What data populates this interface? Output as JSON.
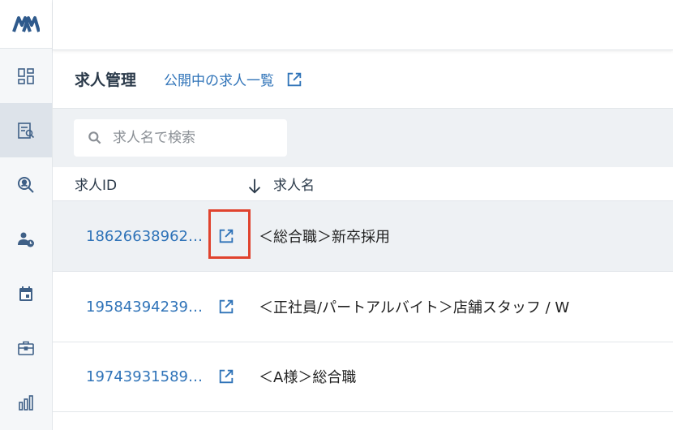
{
  "sidebar": {
    "logo_text": "M",
    "items": [
      {
        "icon": "dashboard-icon"
      },
      {
        "icon": "job-document-search-icon",
        "active": true
      },
      {
        "icon": "candidate-search-icon"
      },
      {
        "icon": "user-clock-icon"
      },
      {
        "icon": "calendar-icon"
      },
      {
        "icon": "briefcase-icon"
      },
      {
        "icon": "bar-chart-icon"
      }
    ]
  },
  "header": {
    "title": "求人管理",
    "link_label": "公開中の求人一覧"
  },
  "search": {
    "placeholder": "求人名で検索"
  },
  "table": {
    "col_id": "求人ID",
    "col_name": "求人名",
    "rows": [
      {
        "id": "18626638962…",
        "name": "＜総合職＞新卒採用"
      },
      {
        "id": "19584394239…",
        "name": "＜正社員/パートアルバイト＞店舗スタッフ / W"
      },
      {
        "id": "19743931589…",
        "name": "＜A様＞総合職"
      }
    ]
  },
  "colors": {
    "accent": "#2f73b8",
    "highlight": "#e0432e",
    "nav": "#3f6087"
  }
}
